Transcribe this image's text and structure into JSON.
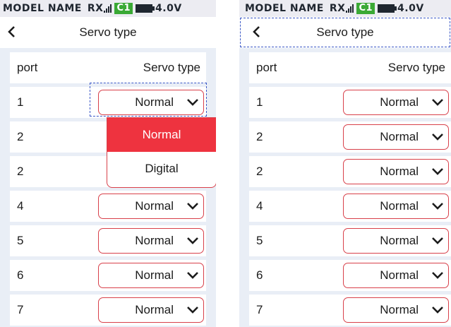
{
  "status_bar": {
    "model_label": "MODEL NAME",
    "rx_label": "RX",
    "channel_badge": "C1",
    "voltage": "4.0V",
    "badge_color": "#3aa935"
  },
  "header": {
    "title": "Servo type",
    "back_icon": "chevron-left-icon"
  },
  "table": {
    "col_port": "port",
    "col_type": "Servo type"
  },
  "left_panel": {
    "rows": [
      {
        "port": "1",
        "type": "Normal"
      },
      {
        "port": "2",
        "type": ""
      },
      {
        "port": "2",
        "type": ""
      },
      {
        "port": "4",
        "type": "Normal"
      },
      {
        "port": "5",
        "type": "Normal"
      },
      {
        "port": "6",
        "type": "Normal"
      },
      {
        "port": "7",
        "type": "Normal"
      }
    ],
    "dropdown": {
      "options": [
        "Normal",
        "Digital"
      ],
      "selected": "Normal",
      "selected_color": "#ee333f"
    }
  },
  "right_panel": {
    "rows": [
      {
        "port": "1",
        "type": "Normal"
      },
      {
        "port": "2",
        "type": "Normal"
      },
      {
        "port": "2",
        "type": "Normal"
      },
      {
        "port": "4",
        "type": "Normal"
      },
      {
        "port": "5",
        "type": "Normal"
      },
      {
        "port": "6",
        "type": "Normal"
      },
      {
        "port": "7",
        "type": "Normal"
      }
    ]
  },
  "accent_color": "#d8404a"
}
